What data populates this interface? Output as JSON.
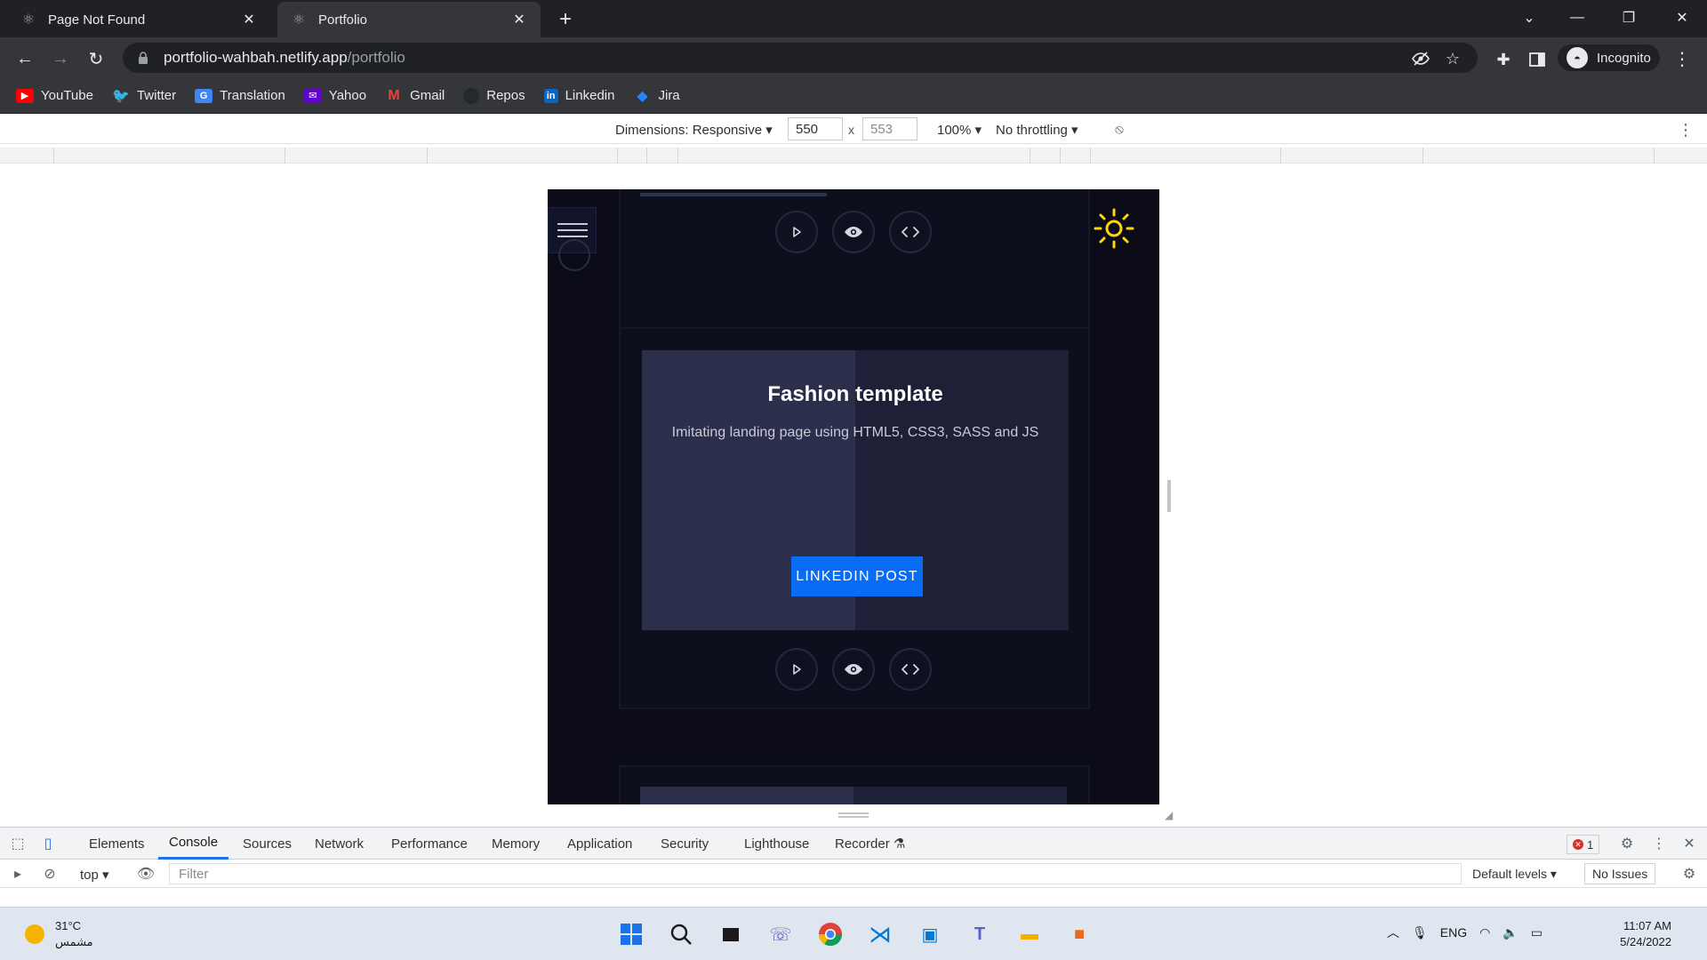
{
  "browser": {
    "tabs": [
      {
        "title": "Page Not Found",
        "active": false
      },
      {
        "title": "Portfolio",
        "active": true
      }
    ],
    "url_host": "portfolio-wahbah.netlify.app",
    "url_path": "/portfolio",
    "profile_label": "Incognito",
    "bookmarks": [
      {
        "label": "YouTube",
        "icon": "youtube-icon",
        "color": "#ff0000"
      },
      {
        "label": "Twitter",
        "icon": "twitter-icon",
        "color": "#1d9bf0"
      },
      {
        "label": "Translation",
        "icon": "translate-icon",
        "color": "#4285f4"
      },
      {
        "label": "Yahoo",
        "icon": "yahoo-icon",
        "color": "#6001d2"
      },
      {
        "label": "Gmail",
        "icon": "gmail-icon",
        "color": "#ea4335"
      },
      {
        "label": "Repos",
        "icon": "github-icon",
        "color": "#24292f"
      },
      {
        "label": "Linkedin",
        "icon": "linkedin-icon",
        "color": "#0a66c2"
      },
      {
        "label": "Jira",
        "icon": "jira-icon",
        "color": "#2684ff"
      }
    ]
  },
  "device_toolbar": {
    "dimensions_label": "Dimensions: Responsive",
    "width_value": "550",
    "height_value": "553",
    "times": "x",
    "zoom": "100%",
    "throttling": "No throttling"
  },
  "page": {
    "card_title": "Fashion template",
    "card_description": "Imitating landing page using HTML5, CSS3, SASS and JS",
    "card_button": "LINKEDIN POST",
    "accent_color": "#0a6cf5",
    "sun_color": "#ffd60a"
  },
  "devtools": {
    "tabs": [
      "Elements",
      "Console",
      "Sources",
      "Network",
      "Performance",
      "Memory",
      "Application",
      "Security",
      "Lighthouse",
      "Recorder"
    ],
    "active_tab": "Console",
    "error_count": "1",
    "context": "top",
    "filter_placeholder": "Filter",
    "levels": "Default levels",
    "issues": "No Issues"
  },
  "taskbar": {
    "temperature": "31°C",
    "weather_desc": "مشمس",
    "language": "ENG",
    "time": "11:07 AM",
    "date": "5/24/2022"
  }
}
